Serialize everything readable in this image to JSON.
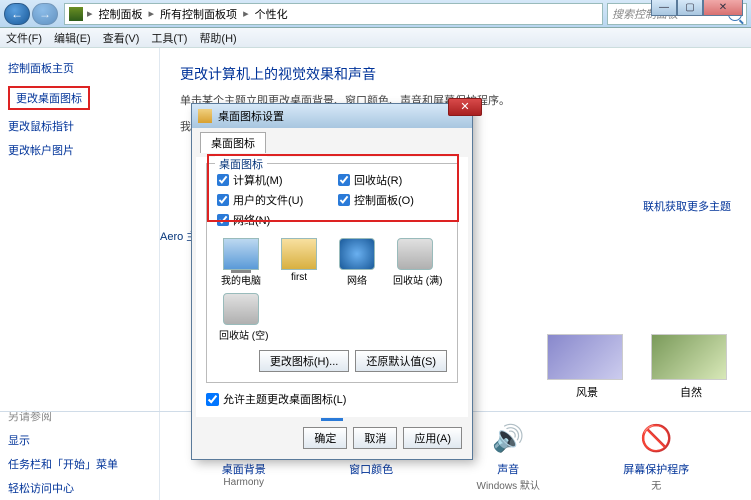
{
  "breadcrumb": {
    "root": "控制面板",
    "items": [
      "所有控制面板项",
      "个性化"
    ]
  },
  "search": {
    "placeholder": "搜索控制面板"
  },
  "menu": {
    "file": "文件(F)",
    "edit": "编辑(E)",
    "view": "查看(V)",
    "tools": "工具(T)",
    "help": "帮助(H)"
  },
  "sidebar": {
    "home": "控制面板主页",
    "links": {
      "icons": "更改桌面图标",
      "pointers": "更改鼠标指针",
      "account_pic": "更改帐户图片"
    },
    "also_hd": "另请参阅",
    "also": {
      "display": "显示",
      "taskbar": "任务栏和「开始」菜单",
      "ease": "轻松访问中心"
    }
  },
  "main": {
    "title": "更改计算机上的视觉效果和声音",
    "subtitle": "单击某个主题立即更改桌面背景、窗口颜色、声音和屏幕保护程序。",
    "my_themes": "我的主",
    "aero": "Aero 主",
    "more_link": "联机获取更多主题",
    "theme1": "风景",
    "theme2": "自然"
  },
  "footer": {
    "bg": {
      "t": "桌面背景",
      "s": "Harmony"
    },
    "color": {
      "t": "窗口颜色",
      "s": ""
    },
    "sound": {
      "t": "声音",
      "s": "Windows 默认"
    },
    "saver": {
      "t": "屏幕保护程序",
      "s": "无"
    }
  },
  "dialog": {
    "title": "桌面图标设置",
    "tab": "桌面图标",
    "group": "桌面图标",
    "chk": {
      "computer": "计算机(M)",
      "userfiles": "用户的文件(U)",
      "network": "网络(N)",
      "recycle": "回收站(R)",
      "cpanel": "控制面板(O)"
    },
    "icons": {
      "computer": "我的电脑",
      "first": "first",
      "network": "网络",
      "bin_full": "回收站 (满)",
      "bin_empty": "回收站 (空)"
    },
    "btn_change": "更改图标(H)...",
    "btn_default": "还原默认值(S)",
    "allow": "允许主题更改桌面图标(L)",
    "ok": "确定",
    "cancel": "取消",
    "apply": "应用(A)"
  }
}
